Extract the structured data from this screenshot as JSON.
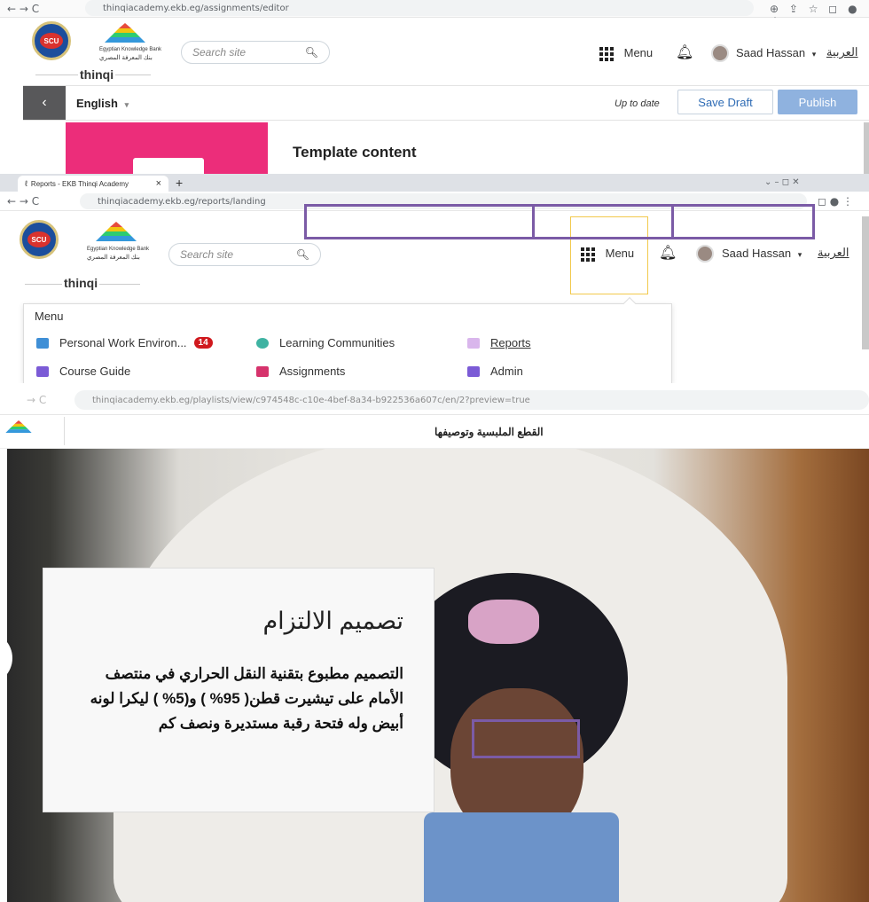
{
  "shot1": {
    "nav": "← → C",
    "url": "thinqiacademy.ekb.eg/assignments/editor",
    "right_icons": "⊕ ⇪ ☆ ◻ ● ⋮",
    "search_placeholder": "Search site",
    "menu_label": "Menu",
    "user_name": "Saad Hassan",
    "arabic_link": "العربية",
    "thinqi": "thinqi",
    "ekb_en": "Egyptian Knowledge Bank",
    "ekb_ar": "بنك المعرفة المصري",
    "scu": "SCU",
    "back_arrow": "‹",
    "language": "English",
    "status": "Up to date",
    "save_draft": "Save Draft",
    "publish": "Publish",
    "template_content": "Template content"
  },
  "shot2": {
    "tab_title": "Reports - EKB Thinqi Academy",
    "tab_close": "×",
    "new_tab": "+",
    "window_controls": "⌄   –   ◻   ✕",
    "nav": "← → C",
    "url": "thinqiacademy.ekb.eg/reports/landing",
    "search_placeholder": "Search site",
    "menu_label": "Menu",
    "user_name": "Saad Hassan",
    "arabic_link": "العربية",
    "thinqi": "thinqi",
    "ekb_en": "Egyptian Knowledge Bank",
    "ekb_ar": "بنك المعرفة المصري",
    "scu": "SCU",
    "dropdown_title": "Menu",
    "items": [
      {
        "label": "Personal Work Environ...",
        "badge": "14",
        "color": "#3f8fd6"
      },
      {
        "label": "Learning Communities",
        "color": "#3fb3a2"
      },
      {
        "label": "Reports",
        "color": "#b98bd6"
      },
      {
        "label": "Course Guide",
        "color": "#7b5bd6"
      },
      {
        "label": "Assignments",
        "color": "#d6336c"
      },
      {
        "label": "Admin",
        "color": "#7b5bd6"
      }
    ]
  },
  "shot3": {
    "nav": "→ C",
    "url": "thinqiacademy.ekb.eg/playlists/view/c974548c-c10e-4bef-8a34-b922536a607c/en/2?preview=true",
    "page_title": "القطع الملبسية وتوصيفها",
    "card_title": "تصميم الالتزام",
    "card_body": "التصميم مطبوع بتقنية النقل الحراري في منتصف الأمام على تيشيرت قطن( 95% ) و(5% ) ليكرا لونه أبيض وله فتحة رقبة مستديرة ونصف كم"
  },
  "colors": {
    "accent_blue": "#2f6cb5",
    "publish_bg": "#8fb2df",
    "pink_block": "#ec2d7a",
    "badge_red": "#d0181d",
    "annotation_purple": "#7b5ba6",
    "highlight_yellow": "#f2c94c"
  }
}
